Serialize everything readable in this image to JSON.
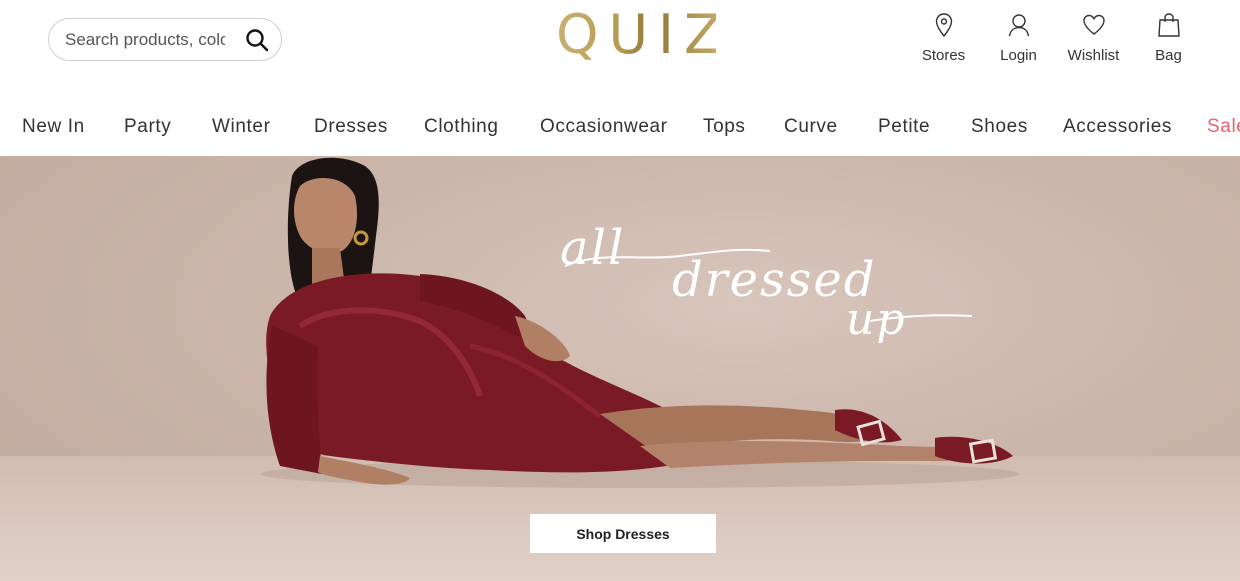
{
  "header": {
    "search": {
      "placeholder": "Search products, colours..."
    },
    "logo_text": "QUIZ",
    "utilities": [
      {
        "label": "Stores",
        "icon": "location-pin-icon"
      },
      {
        "label": "Login",
        "icon": "user-icon"
      },
      {
        "label": "Wishlist",
        "icon": "heart-icon"
      },
      {
        "label": "Bag",
        "icon": "shopping-bag-icon"
      }
    ]
  },
  "nav": {
    "items": [
      "New In",
      "Party",
      "Winter",
      "Dresses",
      "Clothing",
      "Occasionwear",
      "Tops",
      "Curve",
      "Petite",
      "Shoes",
      "Accessories",
      "Sale"
    ]
  },
  "hero": {
    "headline_line1": "all",
    "headline_line2": "dressed",
    "headline_line3": "up",
    "cta_label": "Shop Dresses"
  },
  "colors": {
    "logo_gold": "#b7994f",
    "sale_red": "#e8636b",
    "dress_burgundy": "#7a1a24"
  }
}
